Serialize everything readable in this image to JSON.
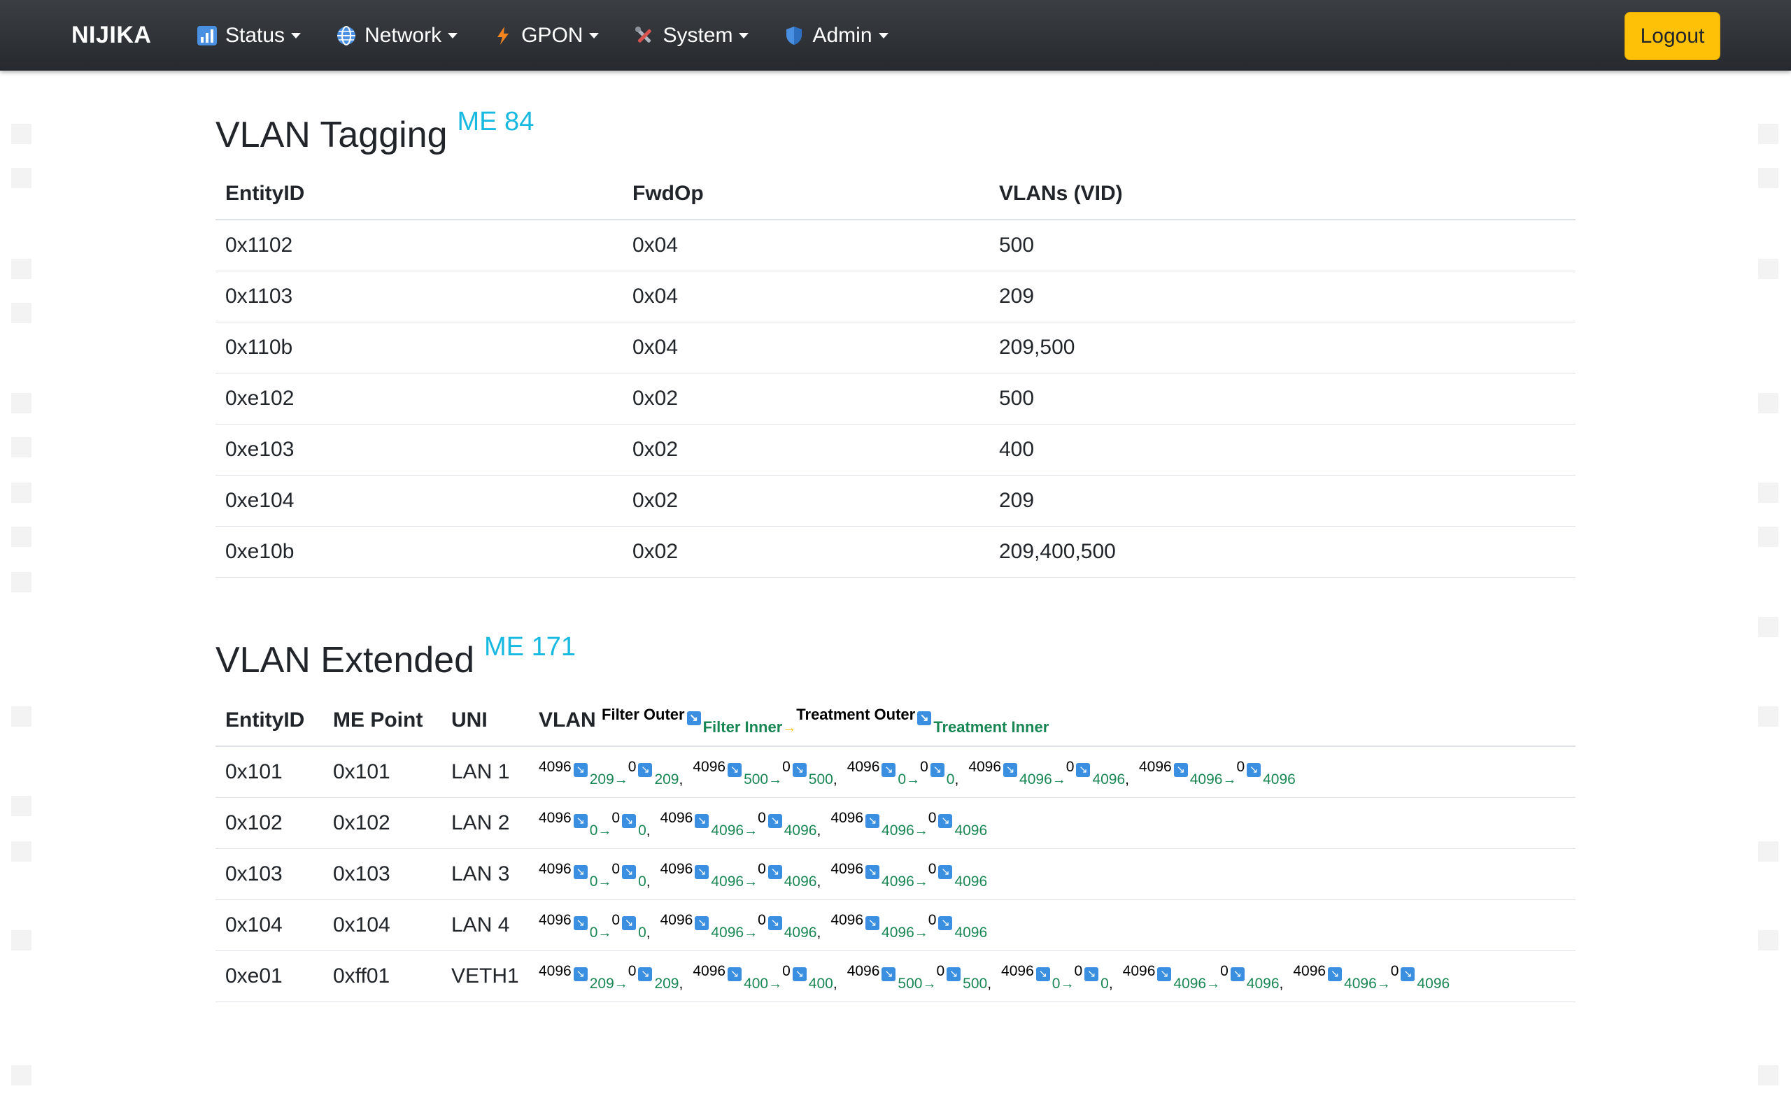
{
  "navbar": {
    "brand": "NIJIKA",
    "items": [
      {
        "label": "Status",
        "icon": "bar-chart-icon"
      },
      {
        "label": "Network",
        "icon": "globe-icon"
      },
      {
        "label": "GPON",
        "icon": "lightning-icon"
      },
      {
        "label": "System",
        "icon": "tools-icon"
      },
      {
        "label": "Admin",
        "icon": "shield-icon"
      }
    ],
    "logout": "Logout"
  },
  "colors": {
    "navbar": "#2f3338",
    "accent_me": "#17b9e0",
    "logout": "#ffc107",
    "green": "#198754",
    "arrow_blue": "#3b8fe0"
  },
  "vlan_tagging": {
    "title": "VLAN Tagging",
    "me": "ME 84",
    "columns": [
      "EntityID",
      "FwdOp",
      "VLANs (VID)"
    ],
    "rows": [
      [
        "0x1102",
        "0x04",
        "500"
      ],
      [
        "0x1103",
        "0x04",
        "209"
      ],
      [
        "0x110b",
        "0x04",
        "209,500"
      ],
      [
        "0xe102",
        "0x02",
        "500"
      ],
      [
        "0xe103",
        "0x02",
        "400"
      ],
      [
        "0xe104",
        "0x02",
        "209"
      ],
      [
        "0xe10b",
        "0x02",
        "209,400,500"
      ]
    ]
  },
  "vlan_extended": {
    "title": "VLAN Extended",
    "me": "ME 171",
    "columns": [
      "EntityID",
      "ME Point",
      "UNI",
      "VLAN"
    ],
    "vlan_legend": {
      "filter_outer": "Filter Outer",
      "filter_inner": "Filter Inner",
      "treatment_outer": "Treatment Outer",
      "treatment_inner": "Treatment Inner"
    },
    "rows": [
      {
        "entity": "0x101",
        "me_point": "0x101",
        "uni": "LAN 1",
        "rules": [
          [
            "4096",
            "209",
            "0",
            "209"
          ],
          [
            "4096",
            "500",
            "0",
            "500"
          ],
          [
            "4096",
            "0",
            "0",
            "0"
          ],
          [
            "4096",
            "4096",
            "0",
            "4096"
          ],
          [
            "4096",
            "4096",
            "0",
            "4096"
          ]
        ]
      },
      {
        "entity": "0x102",
        "me_point": "0x102",
        "uni": "LAN 2",
        "rules": [
          [
            "4096",
            "0",
            "0",
            "0"
          ],
          [
            "4096",
            "4096",
            "0",
            "4096"
          ],
          [
            "4096",
            "4096",
            "0",
            "4096"
          ]
        ]
      },
      {
        "entity": "0x103",
        "me_point": "0x103",
        "uni": "LAN 3",
        "rules": [
          [
            "4096",
            "0",
            "0",
            "0"
          ],
          [
            "4096",
            "4096",
            "0",
            "4096"
          ],
          [
            "4096",
            "4096",
            "0",
            "4096"
          ]
        ]
      },
      {
        "entity": "0x104",
        "me_point": "0x104",
        "uni": "LAN 4",
        "rules": [
          [
            "4096",
            "0",
            "0",
            "0"
          ],
          [
            "4096",
            "4096",
            "0",
            "4096"
          ],
          [
            "4096",
            "4096",
            "0",
            "4096"
          ]
        ]
      },
      {
        "entity": "0xe01",
        "me_point": "0xff01",
        "uni": "VETH1",
        "rules": [
          [
            "4096",
            "209",
            "0",
            "209"
          ],
          [
            "4096",
            "400",
            "0",
            "400"
          ],
          [
            "4096",
            "500",
            "0",
            "500"
          ],
          [
            "4096",
            "0",
            "0",
            "0"
          ],
          [
            "4096",
            "4096",
            "0",
            "4096"
          ],
          [
            "4096",
            "4096",
            "0",
            "4096"
          ]
        ]
      }
    ]
  }
}
